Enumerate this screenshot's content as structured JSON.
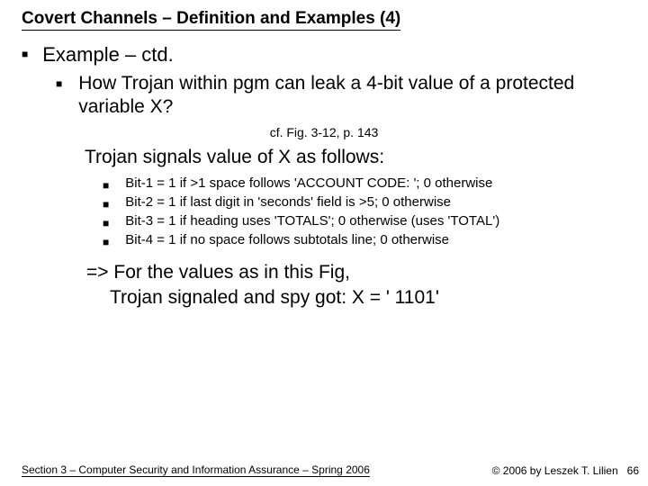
{
  "title": "Covert Channels – Definition and Examples (4)",
  "lvl1": "Example – ctd.",
  "lvl2": "How Trojan within pgm can leak a 4-bit value of a protected variable X?",
  "cf": "cf. Fig. 3-12, p. 143",
  "signal_intro": "Trojan signals value of X as follows:",
  "bits": {
    "b1": "Bit-1 = 1 if >1 space follows 'ACCOUNT CODE: '; 0 otherwise",
    "b2": "Bit-2 = 1 if last digit in 'seconds' field is >5; 0 otherwise",
    "b3": "Bit-3 = 1 if heading uses 'TOTALS'; 0 otherwise (uses 'TOTAL')",
    "b4": "Bit-4 = 1 if no space follows subtotals line; 0 otherwise"
  },
  "conclusion": {
    "l1": "=> For the values as in this Fig,",
    "l2": "Trojan signaled and spy got: X = ' 1101'"
  },
  "footer": {
    "left": "Section 3 – Computer Security and Information Assurance – Spring 2006",
    "right": "© 2006 by Leszek T. Lilien",
    "page": "66"
  },
  "glyphs": {
    "square": "■"
  }
}
